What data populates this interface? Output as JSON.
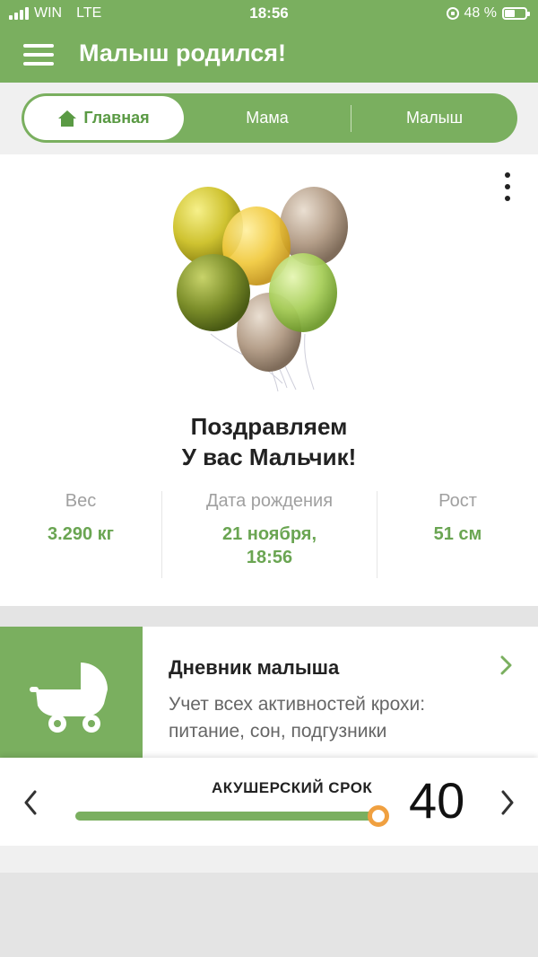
{
  "status_bar": {
    "carrier": "WIN",
    "network": "LTE",
    "time": "18:56",
    "battery": "48 %"
  },
  "app_bar": {
    "title": "Малыш родился!"
  },
  "tabs": [
    {
      "label": "Главная",
      "active": true
    },
    {
      "label": "Мама",
      "active": false
    },
    {
      "label": "Малыш",
      "active": false
    }
  ],
  "congrats": {
    "line1": "Поздравляем",
    "line2": "У вас Мальчик!"
  },
  "stats": {
    "weight": {
      "label": "Вес",
      "value": "3.290 кг"
    },
    "birth_date": {
      "label": "Дата рождения",
      "value_line1": "21 ноября,",
      "value_line2": "18:56"
    },
    "height": {
      "label": "Рост",
      "value": "51 см"
    }
  },
  "diary": {
    "title": "Дневник малыша",
    "description": "Учет всех активностей крохи: питание, сон, подгузники"
  },
  "obstetric_term": {
    "label": "АКУШЕРСКИЙ СРОК",
    "weeks": "40",
    "progress": 1.0
  },
  "colors": {
    "brand_green": "#7aaf5f",
    "value_green": "#6aa552",
    "knob_orange": "#f0a040"
  },
  "icons": [
    "menu-icon",
    "home-icon",
    "more-vert-icon",
    "stroller-icon",
    "chevron-right-icon",
    "chevron-left-icon",
    "balloons-illustration"
  ]
}
